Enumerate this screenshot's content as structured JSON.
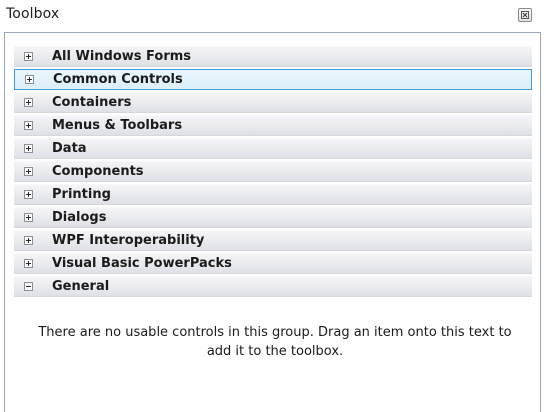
{
  "window": {
    "title": "Toolbox",
    "close_icon": "close-icon"
  },
  "groups": [
    {
      "label": "All Windows Forms",
      "expanded": false,
      "selected": false
    },
    {
      "label": "Common Controls",
      "expanded": false,
      "selected": true
    },
    {
      "label": "Containers",
      "expanded": false,
      "selected": false
    },
    {
      "label": "Menus & Toolbars",
      "expanded": false,
      "selected": false
    },
    {
      "label": "Data",
      "expanded": false,
      "selected": false
    },
    {
      "label": "Components",
      "expanded": false,
      "selected": false
    },
    {
      "label": "Printing",
      "expanded": false,
      "selected": false
    },
    {
      "label": "Dialogs",
      "expanded": false,
      "selected": false
    },
    {
      "label": "WPF Interoperability",
      "expanded": false,
      "selected": false
    },
    {
      "label": "Visual Basic PowerPacks",
      "expanded": false,
      "selected": false
    },
    {
      "label": "General",
      "expanded": true,
      "selected": false
    }
  ],
  "general_group": {
    "empty_message": "There are no usable controls in this group. Drag an item onto this text to add it to the toolbox."
  },
  "colors": {
    "selection_border": "#3e9bd4",
    "selection_fill": "#dbeffa",
    "header_fill": "#e9eaee"
  }
}
